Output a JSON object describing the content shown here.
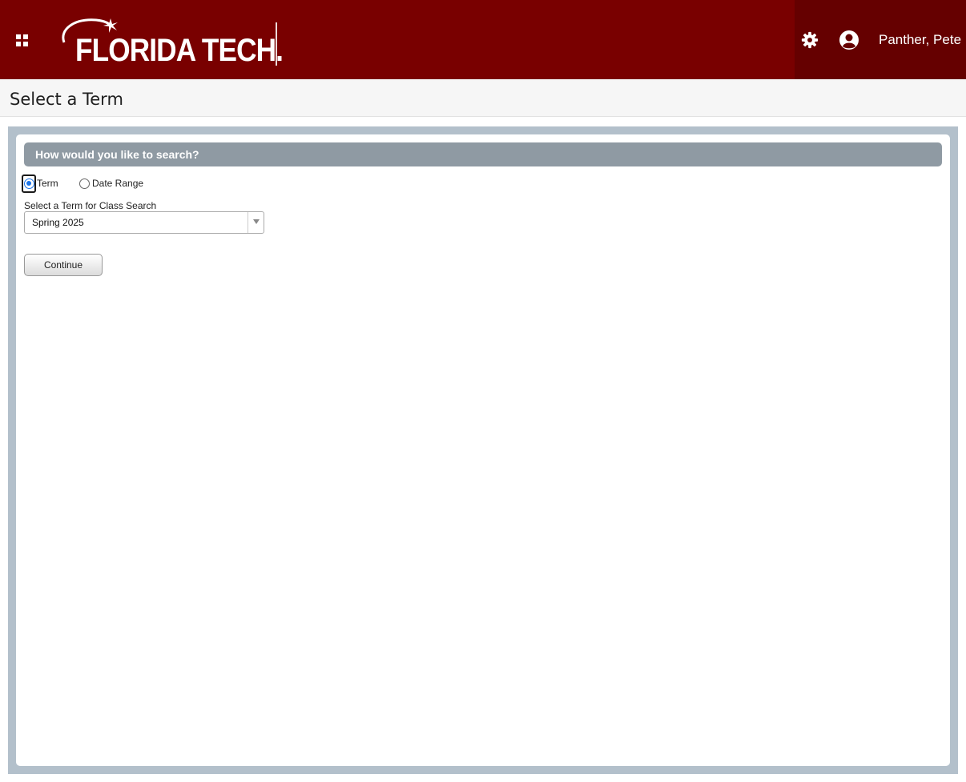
{
  "header": {
    "logo_text": "FLORIDA TECH.",
    "user_name": "Panther, Pete",
    "background_color": "#790000",
    "user_area_color": "#650000"
  },
  "page": {
    "title": "Select a Term"
  },
  "search": {
    "heading": "How would you like to search?",
    "options": [
      {
        "label": "Term",
        "selected": true
      },
      {
        "label": "Date Range",
        "selected": false
      }
    ],
    "term_label": "Select a Term for Class Search",
    "term_value": "Spring 2025",
    "continue_label": "Continue"
  },
  "icons": {
    "apps": "apps-grid-icon",
    "settings": "gear-icon",
    "user": "user-avatar-icon",
    "dropdown": "chevron-down-icon"
  }
}
